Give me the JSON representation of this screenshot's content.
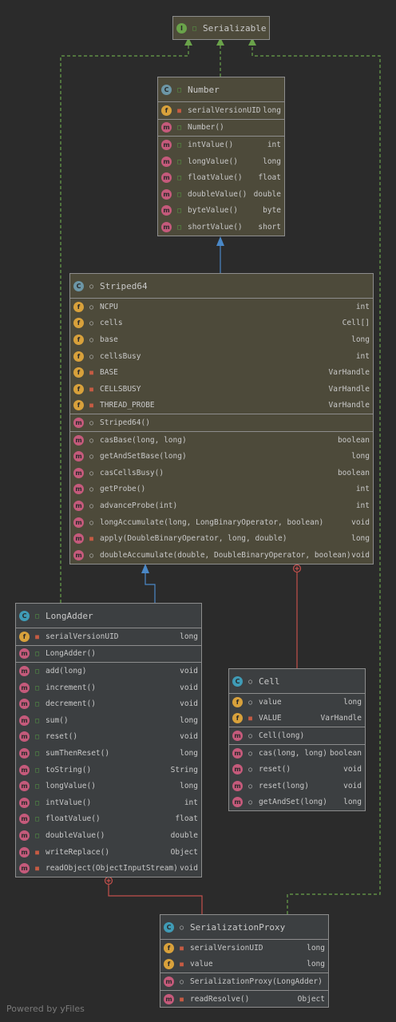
{
  "classes": {
    "serializable": {
      "name": "Serializable",
      "kind": "interface"
    },
    "number": {
      "name": "Number",
      "kind": "abstract-class",
      "fields": [
        {
          "name": "serialVersionUID",
          "type": "long",
          "vis": "private",
          "static": true
        }
      ],
      "constructors": [
        {
          "name": "Number()",
          "type": "",
          "vis": "public"
        }
      ],
      "methods": [
        {
          "name": "intValue()",
          "type": "int",
          "vis": "public",
          "abstract": true
        },
        {
          "name": "longValue()",
          "type": "long",
          "vis": "public",
          "abstract": true
        },
        {
          "name": "floatValue()",
          "type": "float",
          "vis": "public",
          "abstract": true
        },
        {
          "name": "doubleValue()",
          "type": "double",
          "vis": "public",
          "abstract": true
        },
        {
          "name": "byteValue()",
          "type": "byte",
          "vis": "public"
        },
        {
          "name": "shortValue()",
          "type": "short",
          "vis": "public"
        }
      ]
    },
    "striped64": {
      "name": "Striped64",
      "kind": "abstract-class",
      "fields": [
        {
          "name": "NCPU",
          "type": "int",
          "vis": "package",
          "static": true
        },
        {
          "name": "cells",
          "type": "Cell[]",
          "vis": "package"
        },
        {
          "name": "base",
          "type": "long",
          "vis": "package"
        },
        {
          "name": "cellsBusy",
          "type": "int",
          "vis": "package"
        },
        {
          "name": "BASE",
          "type": "VarHandle",
          "vis": "private",
          "static": true
        },
        {
          "name": "CELLSBUSY",
          "type": "VarHandle",
          "vis": "private",
          "static": true
        },
        {
          "name": "THREAD_PROBE",
          "type": "VarHandle",
          "vis": "private",
          "static": true
        }
      ],
      "constructors": [
        {
          "name": "Striped64()",
          "type": "",
          "vis": "package"
        }
      ],
      "methods": [
        {
          "name": "casBase(long, long)",
          "type": "boolean",
          "vis": "package"
        },
        {
          "name": "getAndSetBase(long)",
          "type": "long",
          "vis": "package"
        },
        {
          "name": "casCellsBusy()",
          "type": "boolean",
          "vis": "package"
        },
        {
          "name": "getProbe()",
          "type": "int",
          "vis": "package"
        },
        {
          "name": "advanceProbe(int)",
          "type": "int",
          "vis": "package"
        },
        {
          "name": "longAccumulate(long, LongBinaryOperator, boolean)",
          "type": "void",
          "vis": "package"
        },
        {
          "name": "apply(DoubleBinaryOperator, long, double)",
          "type": "long",
          "vis": "private"
        },
        {
          "name": "doubleAccumulate(double, DoubleBinaryOperator, boolean)",
          "type": "void",
          "vis": "package"
        }
      ]
    },
    "longadder": {
      "name": "LongAdder",
      "kind": "class",
      "fields": [
        {
          "name": "serialVersionUID",
          "type": "long",
          "vis": "private",
          "static": true
        }
      ],
      "constructors": [
        {
          "name": "LongAdder()",
          "type": "",
          "vis": "public"
        }
      ],
      "methods": [
        {
          "name": "add(long)",
          "type": "void",
          "vis": "public"
        },
        {
          "name": "increment()",
          "type": "void",
          "vis": "public"
        },
        {
          "name": "decrement()",
          "type": "void",
          "vis": "public"
        },
        {
          "name": "sum()",
          "type": "long",
          "vis": "public"
        },
        {
          "name": "reset()",
          "type": "void",
          "vis": "public"
        },
        {
          "name": "sumThenReset()",
          "type": "long",
          "vis": "public"
        },
        {
          "name": "toString()",
          "type": "String",
          "vis": "public"
        },
        {
          "name": "longValue()",
          "type": "long",
          "vis": "public"
        },
        {
          "name": "intValue()",
          "type": "int",
          "vis": "public"
        },
        {
          "name": "floatValue()",
          "type": "float",
          "vis": "public"
        },
        {
          "name": "doubleValue()",
          "type": "double",
          "vis": "public"
        },
        {
          "name": "writeReplace()",
          "type": "Object",
          "vis": "private"
        },
        {
          "name": "readObject(ObjectInputStream)",
          "type": "void",
          "vis": "private"
        }
      ]
    },
    "cell": {
      "name": "Cell",
      "kind": "class",
      "fields": [
        {
          "name": "value",
          "type": "long",
          "vis": "package"
        },
        {
          "name": "VALUE",
          "type": "VarHandle",
          "vis": "private",
          "static": true
        }
      ],
      "constructors": [
        {
          "name": "Cell(long)",
          "type": "",
          "vis": "package"
        }
      ],
      "methods": [
        {
          "name": "cas(long, long)",
          "type": "boolean",
          "vis": "package"
        },
        {
          "name": "reset()",
          "type": "void",
          "vis": "package"
        },
        {
          "name": "reset(long)",
          "type": "void",
          "vis": "package"
        },
        {
          "name": "getAndSet(long)",
          "type": "long",
          "vis": "package"
        }
      ]
    },
    "serializationproxy": {
      "name": "SerializationProxy",
      "kind": "class",
      "fields": [
        {
          "name": "serialVersionUID",
          "type": "long",
          "vis": "private",
          "static": true
        },
        {
          "name": "value",
          "type": "long",
          "vis": "private"
        }
      ],
      "constructors": [
        {
          "name": "SerializationProxy(LongAdder)",
          "type": "",
          "vis": "package"
        }
      ],
      "methods": [
        {
          "name": "readResolve()",
          "type": "Object",
          "vis": "private"
        }
      ]
    }
  },
  "footer": "Powered by yFiles",
  "colors": {
    "implements": "#6aa34a",
    "extends": "#4a88c7",
    "inner": "#c4504c"
  }
}
